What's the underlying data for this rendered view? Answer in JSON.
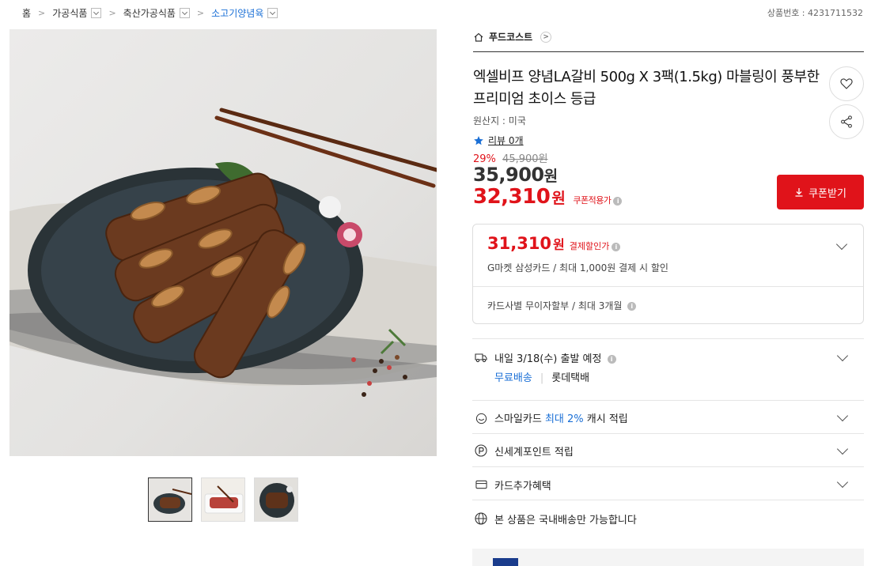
{
  "breadcrumb": {
    "home": "홈",
    "level1": "가공식품",
    "level2": "축산가공식품",
    "level3": "소고기양념육"
  },
  "product_number": "상품번호 : 4231711532",
  "store": {
    "name": "푸드코스트"
  },
  "title": "엑셀비프 양념LA갈비 500g X 3팩(1.5kg) 마블링이 풍부한 프리미엄 초이스 등급",
  "origin": "원산지 : 미국",
  "review": "리뷰 0개",
  "discount": {
    "percent": "29%",
    "original": "45,900원"
  },
  "price": {
    "value": "35,900",
    "unit": "원"
  },
  "coupon_price": {
    "value": "32,310",
    "unit": "원",
    "label": "쿠폰적용가"
  },
  "coupon_button": "쿠폰받기",
  "card_benefit": {
    "value": "31,310",
    "unit": "원",
    "label": "결제할인가",
    "desc": "G마켓 삼성카드 / 최대 1,000원 결제 시 할인",
    "installment": "카드사별 무이자할부 / 최대 3개월"
  },
  "shipping": {
    "title": "내일 3/18(수) 출발 예정",
    "free": "무료배송",
    "carrier": "롯데택배"
  },
  "smilecard": {
    "prefix": "스마일카드",
    "highlight": "최대 2%",
    "suffix": "캐시 적립"
  },
  "points": "신세계포인트 적립",
  "card_extra": "카드추가혜택",
  "domestic": "본 상품은 국내배송만 가능합니다",
  "colors": {
    "accent_red": "#e0131a",
    "link_blue": "#1a6fd6"
  }
}
